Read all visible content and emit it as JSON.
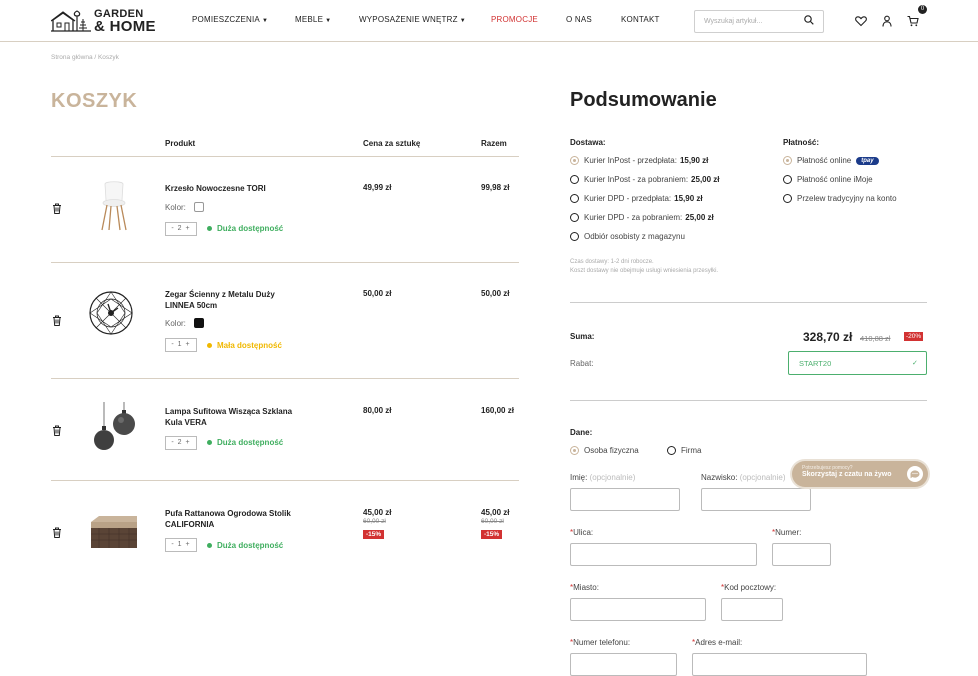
{
  "header": {
    "logo_line1": "GARDEN",
    "logo_line2": "& HOME",
    "nav": [
      {
        "label": "POMIESZCZENIA",
        "dropdown": true
      },
      {
        "label": "MEBLE",
        "dropdown": true
      },
      {
        "label": "WYPOSAŻENIE WNĘTRZ",
        "dropdown": true
      },
      {
        "label": "PROMOCJE",
        "dropdown": false
      },
      {
        "label": "O NAS",
        "dropdown": false
      },
      {
        "label": "KONTAKT",
        "dropdown": false
      }
    ],
    "search_placeholder": "Wyszukaj artykuł...",
    "cart_count": "0",
    "icons": [
      "search-icon",
      "heart-icon",
      "user-icon",
      "cart-icon"
    ]
  },
  "breadcrumb": "Strona główna / Koszyk",
  "cart": {
    "title": "KOSZYK",
    "columns": {
      "product": "Produkt",
      "unit_price": "Cena za sztukę",
      "total": "Razem"
    },
    "items": [
      {
        "name_1": "Krzesło Nowoczesne TORI",
        "name_2": "",
        "color_label": "Kolor:",
        "color": "#ffffff",
        "qty": "- 2 +",
        "availability": "Duża dostępność",
        "avail_color": "#3fae5f",
        "price": "49,99 zł",
        "total": "99,98 zł"
      },
      {
        "name_1": "Zegar Ścienny z Metalu Duży",
        "name_2": "LINNEA 50cm",
        "color_label": "Kolor:",
        "color": "#111111",
        "qty": "- 1 +",
        "availability": "Mała dostępność",
        "avail_color": "#f0b800",
        "price": "50,00 zł",
        "total": "50,00 zł"
      },
      {
        "name_1": "Lampa Sufitowa Wisząca Szklana",
        "name_2": "Kula VERA",
        "qty": "- 2 +",
        "availability": "Duża dostępność",
        "avail_color": "#3fae5f",
        "price": "80,00 zł",
        "total": "160,00 zł"
      },
      {
        "name_1": "Pufa Rattanowa Ogrodowa Stolik",
        "name_2": "CALIFORNIA",
        "qty": "- 1 +",
        "availability": "Duża dostępność",
        "avail_color": "#3fae5f",
        "price": "45,00 zł",
        "old_price": "60,00 zł",
        "discount": "-15%",
        "total": "45,00 zł",
        "old_total": "60,00 zł",
        "total_discount": "-15%"
      }
    ]
  },
  "summary": {
    "title": "Podsumowanie",
    "delivery_label": "Dostawa:",
    "delivery": [
      {
        "text": "Kurier InPost - przedpłata:",
        "price": "15,90 zł",
        "selected": true
      },
      {
        "text": "Kurier InPost - za pobraniem:",
        "price": "25,00 zł",
        "selected": false
      },
      {
        "text": "Kurier DPD - przedpłata:",
        "price": "15,90 zł",
        "selected": false
      },
      {
        "text": "Kurier DPD - za pobraniem:",
        "price": "25,00 zł",
        "selected": false
      },
      {
        "text": "Odbiór osobisty z magazynu",
        "price": "",
        "selected": false
      }
    ],
    "payment_label": "Płatność:",
    "payment": [
      {
        "text": "Płatność online",
        "badge": "tpay",
        "selected": true
      },
      {
        "text": "Płatność online iMoje",
        "selected": false
      },
      {
        "text": "Przelew tradycyjny na konto",
        "selected": false
      }
    ],
    "note_1": "Czas dostawy: 1-2 dni robocze.",
    "note_2": "Koszt dostawy nie obejmuje usługi wniesienia przesyłki.",
    "sum_label": "Suma:",
    "sum_value": "328,70 zł",
    "sum_old": "410,88 zł",
    "sum_discount": "-20%",
    "rabat_label": "Rabat:",
    "rabat_code": "START20",
    "rabat_check": "✓"
  },
  "data_form": {
    "title": "Dane:",
    "person_options": [
      {
        "text": "Osoba fizyczna",
        "selected": true
      },
      {
        "text": "Firma",
        "selected": false
      }
    ],
    "imie_label": "Imię:",
    "imie_opt": "(opcjonalnie)",
    "nazwisko_label": "Nazwisko:",
    "nazwisko_opt": "(opcjonalnie)",
    "req_mark": "*",
    "ulica_label": "Ulica:",
    "numer_label": "Numer:",
    "miasto_label": "Miasto:",
    "kod_label": "Kod pocztowy:",
    "telefon_label": "Numer telefonu:",
    "email_label": "Adres e-mail:"
  },
  "chat": {
    "small": "Potrzebujesz pomocy?",
    "big": "Skorzystaj z czatu na żywo"
  }
}
